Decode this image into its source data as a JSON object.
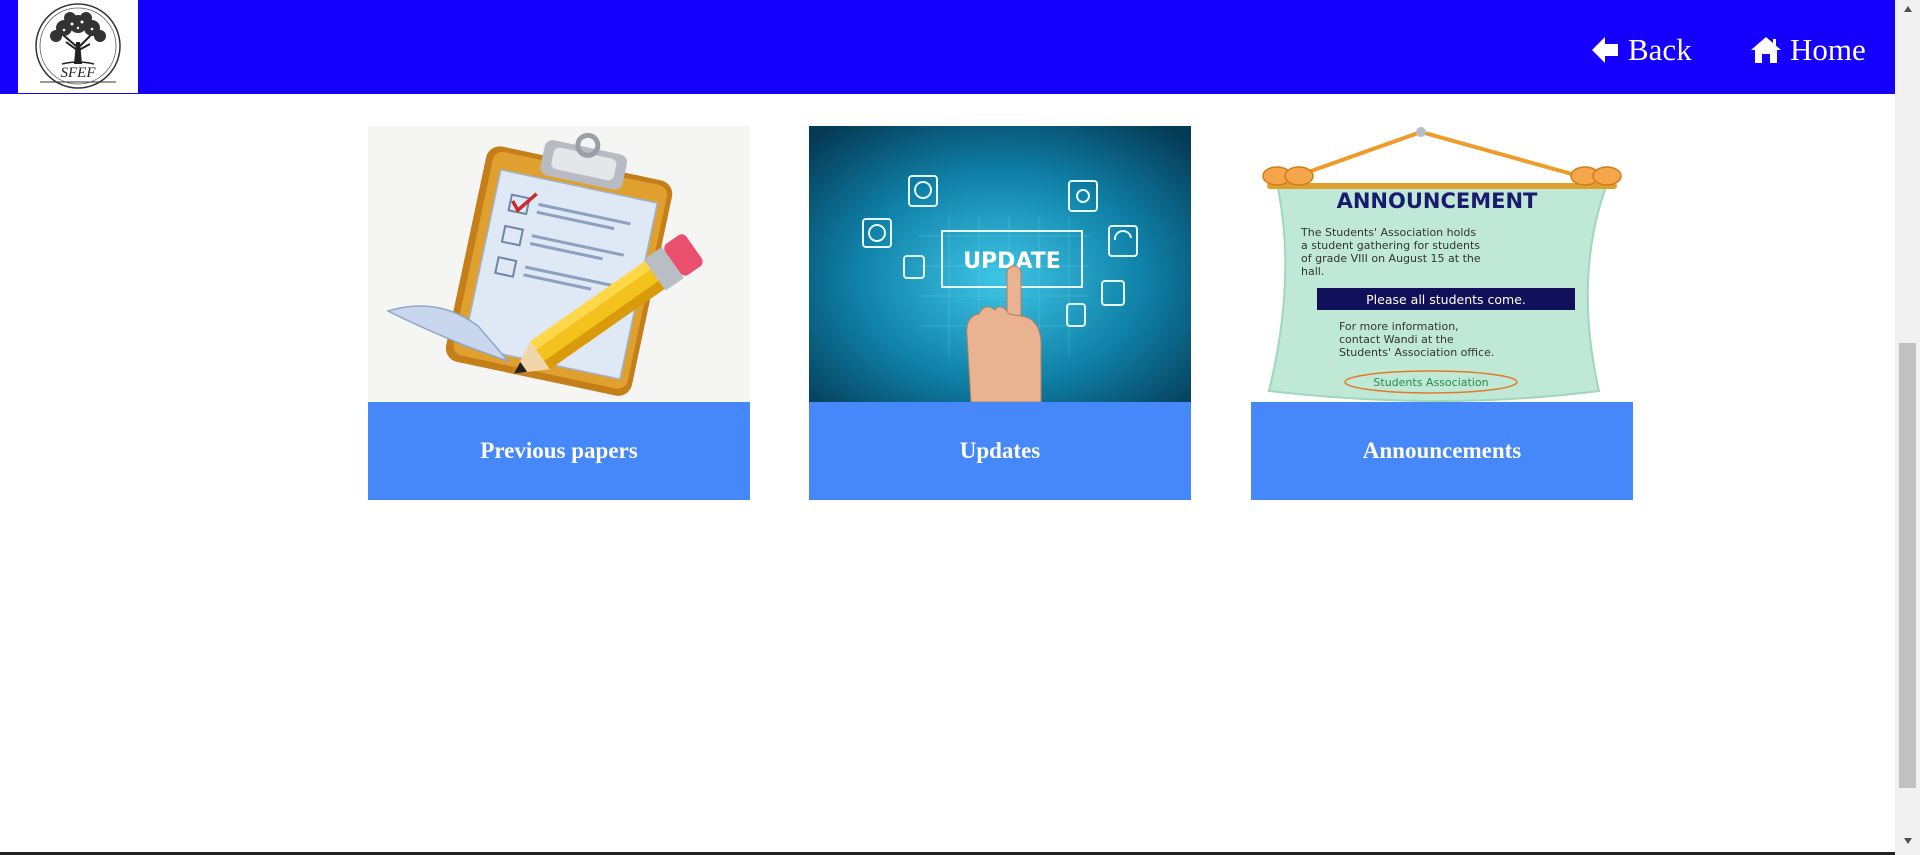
{
  "header": {
    "logo_text": "SFEF",
    "back_label": "Back",
    "home_label": "Home"
  },
  "cards": [
    {
      "label": "Previous papers"
    },
    {
      "label": "Updates",
      "image_text": "UPDATE"
    },
    {
      "label": "Announcements",
      "image_title": "ANNOUNCEMENT",
      "image_body": [
        "The Students' Association holds",
        "a student gathering for students",
        "of grade VIII on August 15 at the",
        "hall."
      ],
      "image_banner": "Please all students come.",
      "image_footer": [
        "For more information,",
        "contact Wandi at the",
        "Students' Association office."
      ],
      "image_signature": "Students Association"
    }
  ],
  "colors": {
    "topbar": "#1500ff",
    "caption": "#4687f9",
    "scrollbar_thumb": "#c1c1c1"
  }
}
